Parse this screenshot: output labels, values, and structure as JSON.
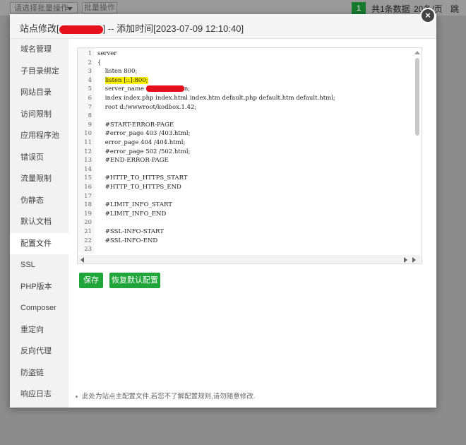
{
  "background": {
    "batch_select_placeholder": "请选择批量操作",
    "batch_button": "批量操作",
    "current_page": "1",
    "total_text": "共1条数据",
    "per_page": "20条/页",
    "jump": "跳"
  },
  "modal": {
    "title_prefix": "站点修改[",
    "title_suffix": "] -- 添加时间[2023-07-09 12:10:40]",
    "close_icon": "×",
    "sidebar": [
      "域名管理",
      "子目录绑定",
      "网站目录",
      "访问限制",
      "应用程序池",
      "错误页",
      "流量限制",
      "伪静态",
      "默认文档",
      "配置文件",
      "SSL",
      "PHP版本",
      "Composer",
      "重定向",
      "反向代理",
      "防盗链",
      "响应日志"
    ],
    "active_item": "配置文件",
    "editor": {
      "line_numbers": [
        "1",
        "2",
        "3",
        "4",
        "5",
        "6",
        "7",
        "8",
        "9",
        "10",
        "11",
        "12",
        "13",
        "14",
        "15",
        "16",
        "17",
        "18",
        "19",
        "20",
        "21",
        "22",
        "23"
      ],
      "lines": [
        "server",
        "{",
        "    listen 800;",
        "    listen [::]:800;",
        "    server_name ",
        "    index index.php index.html index.htm default.php default.htm default.html;",
        "    root d:/wwwroot/kodbox.1.42;",
        "",
        "    #START-ERROR-PAGE",
        "    #error_page 403 /403.html;",
        "    error_page 404 /404.html;",
        "    #error_page 502 /502.html;",
        "    #END-ERROR-PAGE",
        "",
        "    #HTTP_TO_HTTPS_START",
        "    #HTTP_TO_HTTPS_END",
        "",
        "    #LIMIT_INFO_START",
        "    #LIMIT_INFO_END",
        "",
        "    #SSL-INFO-START",
        "    #SSL-INFO-END",
        ""
      ],
      "server_name_tail": "n;"
    },
    "save_label": "保存",
    "restore_label": "恢复默认配置",
    "note": "此处为站点主配置文件,若您不了解配置规则,请勿随意修改."
  },
  "colors": {
    "accent": "#20a53a",
    "highlight": "#fff200",
    "redaction": "#e4101b"
  }
}
